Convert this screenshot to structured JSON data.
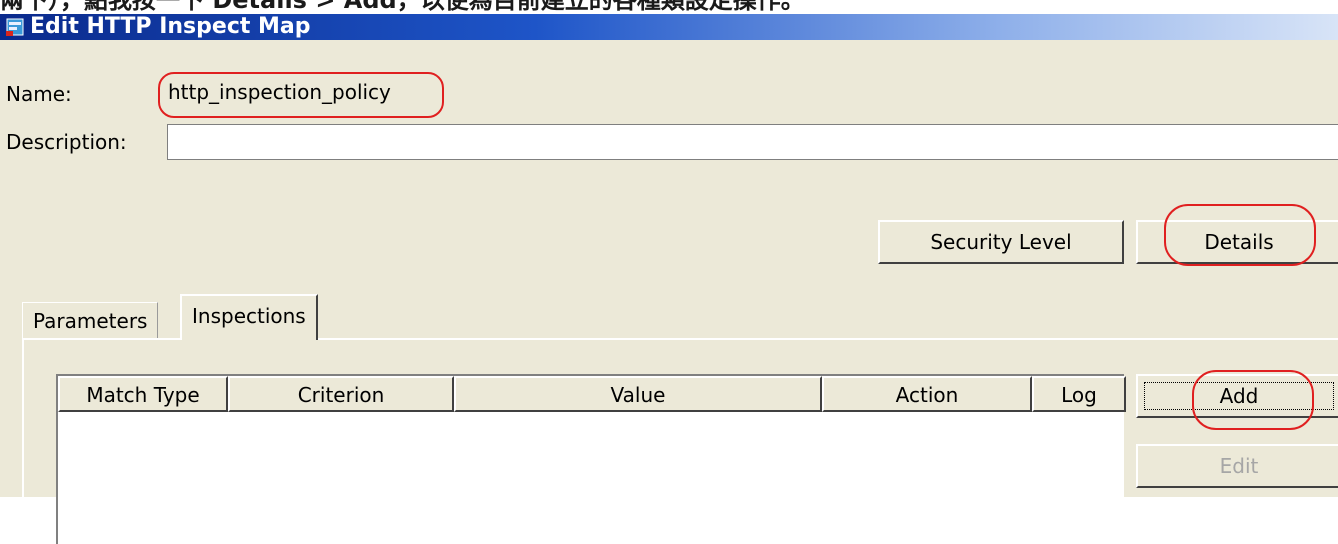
{
  "caption": "兩下），點我按一下 Details > Add，以便為目前建立的各種類設定操作。",
  "window": {
    "title": "Edit HTTP  Inspect Map",
    "icon": "app-icon"
  },
  "form": {
    "name_label": "Name:",
    "name_value": "http_inspection_policy",
    "description_label": "Description:",
    "description_value": ""
  },
  "buttons": {
    "security_level": "Security Level",
    "details": "Details",
    "add": "Add",
    "edit": "Edit"
  },
  "tabs": [
    {
      "label": "Parameters",
      "active": false
    },
    {
      "label": "Inspections",
      "active": true
    }
  ],
  "table": {
    "columns": [
      "Match Type",
      "Criterion",
      "Value",
      "Action",
      "Log"
    ],
    "rows": []
  },
  "annotations": {
    "highlight_color": "#e02020",
    "highlighted": [
      "name-value",
      "details-button",
      "add-button"
    ]
  }
}
